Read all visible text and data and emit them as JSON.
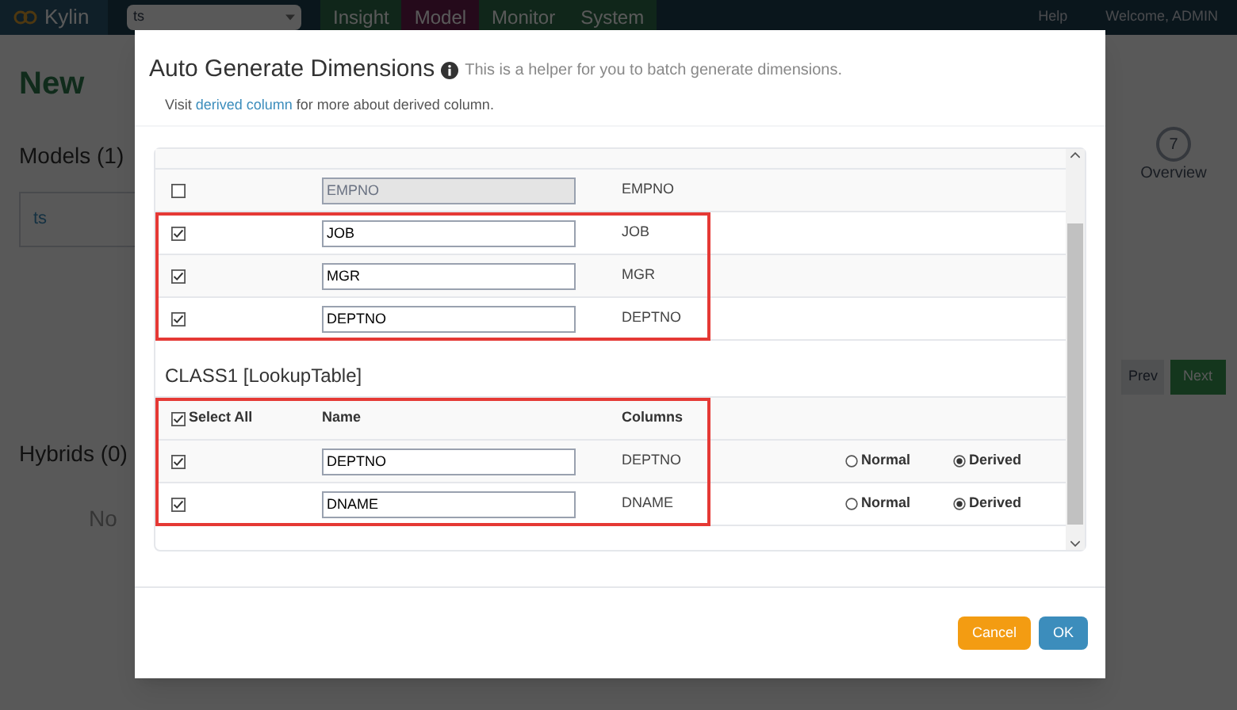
{
  "app": {
    "brand": "Kylin",
    "project_select": "ts",
    "nav_tabs": [
      {
        "label": "Insight",
        "selected": false
      },
      {
        "label": "Model",
        "selected": true
      },
      {
        "label": "Monitor",
        "selected": false
      },
      {
        "label": "System",
        "selected": false
      }
    ],
    "help": "Help",
    "welcome": "Welcome, ADMIN",
    "new_button": "New",
    "models_heading": "Models (1)",
    "models": [
      "ts"
    ],
    "hybrids_heading": "Hybrids (0)",
    "hybrids_empty": "No",
    "step": {
      "number": "7",
      "label": "Overview"
    },
    "prev_button": "Prev",
    "next_button": "Next"
  },
  "dialog": {
    "title": "Auto Generate Dimensions",
    "hint": "This is a helper for you to batch generate dimensions.",
    "note": {
      "before": "Visit",
      "link": "derived column",
      "after": "for more about derived column."
    },
    "tables": [
      {
        "rows": [
          {
            "checked": false,
            "disabled": true,
            "highlighted": false,
            "name": "EMPNO",
            "column": "EMPNO"
          },
          {
            "checked": true,
            "disabled": false,
            "highlighted": true,
            "name": "JOB",
            "column": "JOB"
          },
          {
            "checked": true,
            "disabled": false,
            "highlighted": true,
            "name": "MGR",
            "column": "MGR"
          },
          {
            "checked": true,
            "disabled": false,
            "highlighted": true,
            "name": "DEPTNO",
            "column": "DEPTNO"
          }
        ]
      },
      {
        "heading": "CLASS1 [LookupTable]",
        "header": {
          "select_all": "Select All",
          "checked": true,
          "name": "Name",
          "columns": "Columns",
          "highlighted": true
        },
        "rows": [
          {
            "checked": true,
            "disabled": false,
            "highlighted": true,
            "name": "DEPTNO",
            "column": "DEPTNO",
            "options": [
              {
                "label": "Normal",
                "selected": false
              },
              {
                "label": "Derived",
                "selected": true
              }
            ]
          },
          {
            "checked": true,
            "disabled": false,
            "highlighted": true,
            "name": "DNAME",
            "column": "DNAME",
            "options": [
              {
                "label": "Normal",
                "selected": false
              },
              {
                "label": "Derived",
                "selected": true
              }
            ]
          }
        ]
      }
    ],
    "buttons": [
      {
        "label": "Cancel",
        "kind": "cancel"
      },
      {
        "label": "OK",
        "kind": "ok"
      }
    ]
  }
}
